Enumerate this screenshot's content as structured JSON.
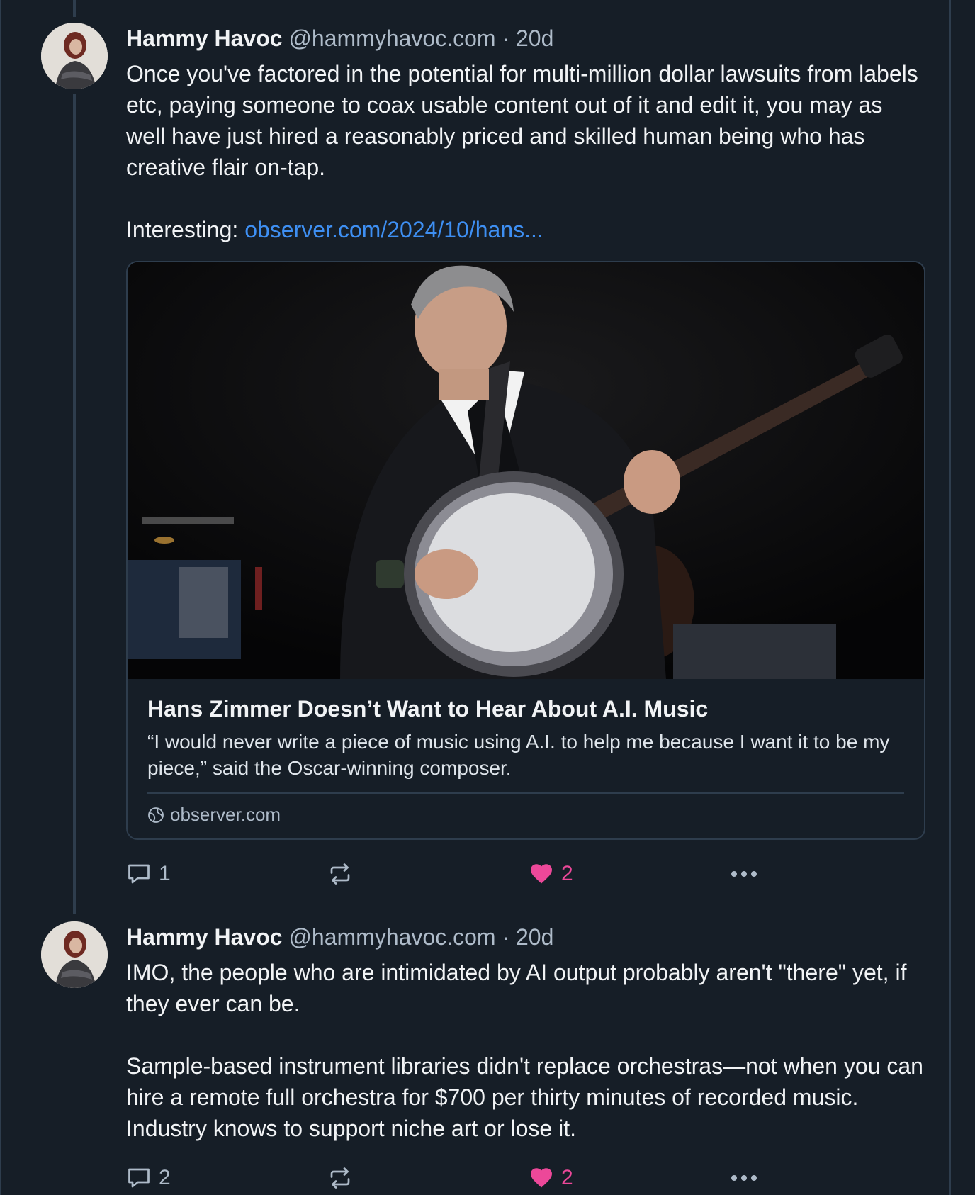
{
  "posts": [
    {
      "author": {
        "name": "Hammy Havoc",
        "handle": "@hammyhavoc.com",
        "separator": "·",
        "time": "20d"
      },
      "text": {
        "para1": "Once you've factored in the potential for multi-million dollar lawsuits from labels etc, paying someone to coax usable content out of it and edit it, you may as well have just hired a reasonably priced and skilled human being who has creative flair on-tap.",
        "para2_prefix": "Interesting: ",
        "link": "observer.com/2024/10/hans..."
      },
      "embed": {
        "title": "Hans Zimmer Doesn’t Want to Hear About A.I. Music",
        "description": "“I would never write a piece of music using A.I. to help me because I want it to be my piece,” said the Oscar-winning composer.",
        "domain": "observer.com"
      },
      "actions": {
        "reply_count": "1",
        "repost_count": "",
        "like_count": "2"
      }
    },
    {
      "author": {
        "name": "Hammy Havoc",
        "handle": "@hammyhavoc.com",
        "separator": "·",
        "time": "20d"
      },
      "text": {
        "para1": "IMO, the people who are intimidated by AI output probably aren't \"there\" yet, if they ever can be.",
        "para2": "Sample-based instrument libraries didn't replace orchestras—not when you can hire a remote full orchestra for $700 per thirty minutes of recorded music. Industry knows to support niche art or lose it."
      },
      "actions": {
        "reply_count": "2",
        "repost_count": "",
        "like_count": "2"
      }
    }
  ],
  "icons": {
    "reply": "speech-bubble-icon",
    "repost": "repost-arrows-icon",
    "like": "heart-icon",
    "more": "ellipsis-icon",
    "globe": "globe-icon"
  },
  "colors": {
    "background": "#161e27",
    "border": "#2e3d4d",
    "text": "#f1f3f5",
    "muted": "#aebbc9",
    "link": "#3e8ff2",
    "like": "#ec4899"
  }
}
